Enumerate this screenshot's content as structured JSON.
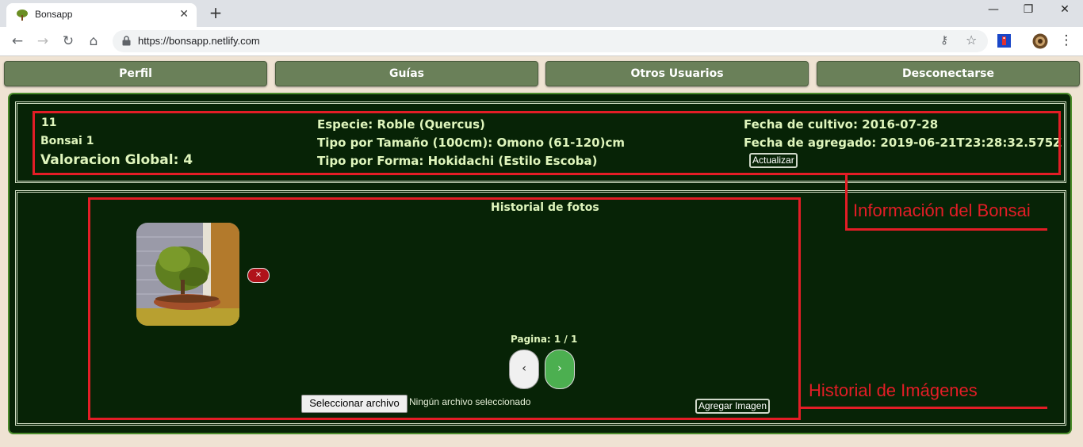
{
  "browser": {
    "tab_title": "Bonsapp",
    "url": "https://bonsapp.netlify.com",
    "window_controls": {
      "minimize": "—",
      "restore": "❐",
      "close": "✕"
    },
    "tab_close": "✕",
    "new_tab": "+",
    "nav_icons": {
      "back": "←",
      "forward": "→",
      "reload": "↻",
      "home": "⌂"
    },
    "omni_icons": {
      "key": "⚷",
      "star": "☆"
    },
    "menu": "⋮"
  },
  "nav": {
    "perfil": "Perfil",
    "guias": "Guías",
    "otros_usuarios": "Otros Usuarios",
    "desconectarse": "Desconectarse"
  },
  "bonsai": {
    "id": "11",
    "name": "Bonsai 1",
    "rating": "Valoracion Global: 4",
    "species": "Especie: Roble (Quercus)",
    "size_type": "Tipo por Tamaño (100cm): Omono (61-120)cm",
    "shape_type": "Tipo por Forma: Hokidachi (Estilo Escoba)",
    "cultivation_date": "Fecha de cultivo: 2016-07-28",
    "added_date": "Fecha de agregado: 2019-06-21T23:28:32.575Z",
    "update_label": "Actualizar"
  },
  "history": {
    "title": "Historial de fotos",
    "delete_label": "×",
    "page_label": "Pagina: 1 / 1",
    "prev_label": "‹",
    "next_label": "›",
    "file_button": "Seleccionar archivo",
    "file_status": "Ningún archivo seleccionado",
    "add_image_label": "Agregar Imagen"
  },
  "annotations": {
    "info": "Información del Bonsai",
    "history": "Historial de Imágenes"
  },
  "colors": {
    "panel_bg": "#072306",
    "nav_button": "#6a8059",
    "text": "#dff5bc",
    "annotation": "#e31d26",
    "next_button": "#4caf50"
  }
}
